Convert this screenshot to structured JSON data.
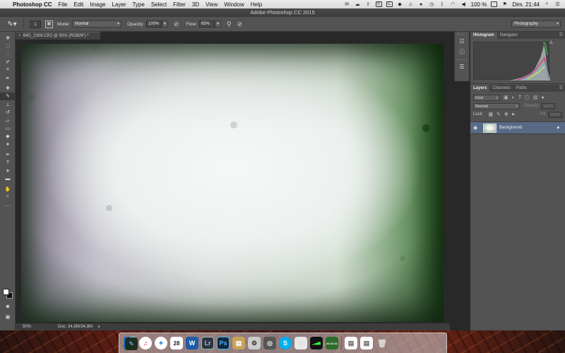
{
  "menubar": {
    "app_name": "Photoshop CC",
    "items": [
      "File",
      "Edit",
      "Image",
      "Layer",
      "Type",
      "Select",
      "Filter",
      "3D",
      "View",
      "Window",
      "Help"
    ],
    "battery": "100 %",
    "clock": "Dim. 21:44"
  },
  "window": {
    "title": "Adobe Photoshop CC 2015"
  },
  "options": {
    "brush_size": "1",
    "mode_label": "Mode:",
    "mode_value": "Normal",
    "opacity_label": "Opacity:",
    "opacity_value": "100%",
    "flow_label": "Flow:",
    "flow_value": "65%",
    "workspace": "Photography"
  },
  "document": {
    "tab_title": "IMG_2308.CR2 @ 50% (RGB/8*) *",
    "zoom": "50%",
    "doc_size": "Doc: 34,8M/34,8M"
  },
  "panels": {
    "top_tabs": [
      "Histogram",
      "Navigator"
    ],
    "layer_tabs": [
      "Layers",
      "Channels",
      "Paths"
    ],
    "kind_filter": "Kind",
    "blend_mode": "Normal",
    "opacity_label": "Opacity:",
    "opacity_value": "100%",
    "lock_label": "Lock:",
    "fill_label": "Fill:",
    "fill_value": "100%",
    "layers": [
      {
        "name": "Background",
        "visible": true,
        "locked": true
      }
    ]
  },
  "dock": {
    "calendar_day": "28",
    "clock_widget": "20:10:11",
    "items": [
      "finder",
      "itunes",
      "preview",
      "safari",
      "calendar",
      "word",
      "lightroom",
      "photoshop",
      "stack",
      "preferences",
      "app",
      "skype",
      "app2",
      "activity",
      "time",
      "document",
      "document2",
      "trash"
    ]
  },
  "colors": {
    "panel_bg": "#535353",
    "dark_bg": "#282828",
    "layer_selected": "#596a86"
  }
}
